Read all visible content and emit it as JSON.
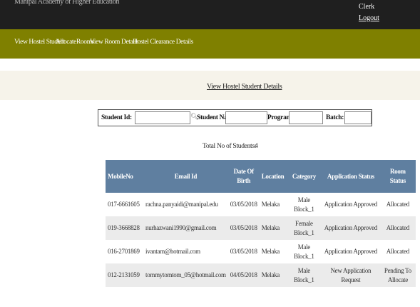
{
  "topbar": {
    "brand": "Manipal Academy of Higher Education",
    "role": "Clerk",
    "logout": "Logout"
  },
  "nav": [
    {
      "label": "View Hostel Student"
    },
    {
      "label": "AllocateRooms"
    },
    {
      "label": "View Room Details"
    },
    {
      "label": "Hostel Clearance Details"
    }
  ],
  "page_title": "View Hostel Student Details",
  "search": {
    "student_id_label": "Student Id:",
    "student_id_value": "",
    "student_name_label": "Student Name:",
    "student_name_value": "",
    "program_label": "Program:",
    "program_value": "",
    "batch_label": "Batch:",
    "batch_value": ""
  },
  "total": {
    "label": "Total No of Students:",
    "count": "4"
  },
  "table": {
    "headers": {
      "mobile": "MobileNo",
      "email": "Email Id",
      "dob": "Date Of Birth",
      "location": "Location",
      "category": "Category",
      "app_status": "Application Status",
      "room_status": "Room Status"
    },
    "rows": [
      {
        "mobile": "017-6661605",
        "email": "rachna.panyaidi@manipal.edu",
        "dob": "03/05/2018",
        "location": "Melaka",
        "category": "Male Block_1",
        "app_status": "Application Approved",
        "room_status": "Allocated"
      },
      {
        "mobile": "019-3668828",
        "email": "nurhazwani1990@gmail.com",
        "dob": "03/05/2018",
        "location": "Melaka",
        "category": "Female Block_1",
        "app_status": "Application Approved",
        "room_status": "Allocated"
      },
      {
        "mobile": "016-2701869",
        "email": "ivantam@hotmail.com",
        "dob": "03/05/2018",
        "location": "Melaka",
        "category": "Male Block_1",
        "app_status": "Application Approved",
        "room_status": "Allocated"
      },
      {
        "mobile": "012-2131059",
        "email": "tommytomtom_05@hotmail.com",
        "dob": "04/05/2018",
        "location": "Melaka",
        "category": "Male Block_1",
        "app_status": "New Application Request",
        "room_status": "Pending To Allocate"
      }
    ]
  }
}
